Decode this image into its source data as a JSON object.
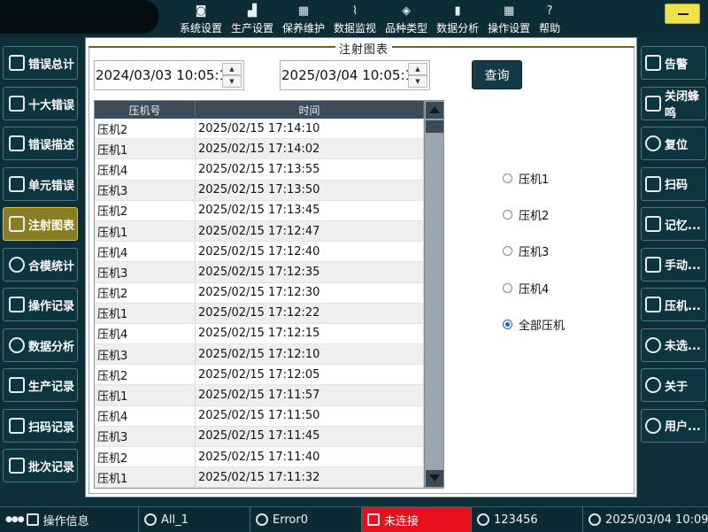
{
  "top_nav": [
    {
      "label": "系统设置",
      "icon": "camera-icon"
    },
    {
      "label": "生产设置",
      "icon": "machine-icon"
    },
    {
      "label": "保养维护",
      "icon": "calendar-icon"
    },
    {
      "label": "数据监视",
      "icon": "chart-monitor-icon"
    },
    {
      "label": "品种类型",
      "icon": "layers-icon"
    },
    {
      "label": "数据分析",
      "icon": "bar-chart-icon"
    },
    {
      "label": "操作设置",
      "icon": "grid-icon"
    },
    {
      "label": "帮助",
      "icon": "help-icon"
    }
  ],
  "left_sidebar": [
    {
      "label": "错误总计",
      "icon": "error-total-icon"
    },
    {
      "label": "十大错误",
      "icon": "warning-house-icon"
    },
    {
      "label": "错误描述",
      "icon": "document-icon"
    },
    {
      "label": "单元错误",
      "icon": "warning-triangle-icon"
    },
    {
      "label": "注射图表",
      "icon": "injection-chart-icon",
      "active": true
    },
    {
      "label": "合模统计",
      "icon": "pie-chart-icon"
    },
    {
      "label": "操作记录",
      "icon": "log-icon"
    },
    {
      "label": "数据分析",
      "icon": "pie-analysis-icon"
    },
    {
      "label": "生产记录",
      "icon": "production-log-icon"
    },
    {
      "label": "扫码记录",
      "icon": "barcode-icon"
    },
    {
      "label": "批次记录",
      "icon": "batch-log-icon"
    }
  ],
  "right_sidebar": [
    {
      "label": "告警",
      "icon": "alarm-icon"
    },
    {
      "label": "关闭蜂鸣",
      "icon": "mute-icon"
    },
    {
      "label": "复位",
      "icon": "reset-icon"
    },
    {
      "label": "扫码",
      "icon": "scan-icon"
    },
    {
      "label": "记忆...",
      "icon": "memory-icon"
    },
    {
      "label": "手动...",
      "icon": "hand-icon"
    },
    {
      "label": "压机...",
      "icon": "press-icon"
    },
    {
      "label": "未选...",
      "icon": "no-select-icon"
    },
    {
      "label": "关于",
      "icon": "info-icon"
    },
    {
      "label": "用户...",
      "icon": "user-icon"
    }
  ],
  "panel": {
    "title": "注射图表",
    "start_datetime": "2024/03/03 10:05:1",
    "end_datetime": "2025/03/04 10:05:1",
    "query_label": "查询"
  },
  "table": {
    "headers": [
      "压机号",
      "时间"
    ],
    "rows": [
      [
        "压机2",
        "2025/02/15 17:14:10"
      ],
      [
        "压机1",
        "2025/02/15 17:14:02"
      ],
      [
        "压机4",
        "2025/02/15 17:13:55"
      ],
      [
        "压机3",
        "2025/02/15 17:13:50"
      ],
      [
        "压机2",
        "2025/02/15 17:13:45"
      ],
      [
        "压机1",
        "2025/02/15 17:12:47"
      ],
      [
        "压机4",
        "2025/02/15 17:12:40"
      ],
      [
        "压机3",
        "2025/02/15 17:12:35"
      ],
      [
        "压机2",
        "2025/02/15 17:12:30"
      ],
      [
        "压机1",
        "2025/02/15 17:12:22"
      ],
      [
        "压机4",
        "2025/02/15 17:12:15"
      ],
      [
        "压机3",
        "2025/02/15 17:12:10"
      ],
      [
        "压机2",
        "2025/02/15 17:12:05"
      ],
      [
        "压机1",
        "2025/02/15 17:11:57"
      ],
      [
        "压机4",
        "2025/02/15 17:11:50"
      ],
      [
        "压机3",
        "2025/02/15 17:11:45"
      ],
      [
        "压机2",
        "2025/02/15 17:11:40"
      ],
      [
        "压机1",
        "2025/02/15 17:11:32"
      ]
    ]
  },
  "radios": [
    {
      "label": "压机1",
      "checked": false
    },
    {
      "label": "压机2",
      "checked": false
    },
    {
      "label": "压机3",
      "checked": false
    },
    {
      "label": "压机4",
      "checked": false
    },
    {
      "label": "全部压机",
      "checked": true
    }
  ],
  "status_bar": {
    "operation_info": "操作信息",
    "recipe": "All_1",
    "error": "Error0",
    "connection": "未连接",
    "user": "123456",
    "datetime": "2025/03/04 10:09:"
  },
  "colors": {
    "background": "#0f2f38",
    "active_sidebar": "#8a7d21",
    "alert": "#e8101c",
    "query_button": "#123a47",
    "minimize_button": "#efe34a"
  }
}
